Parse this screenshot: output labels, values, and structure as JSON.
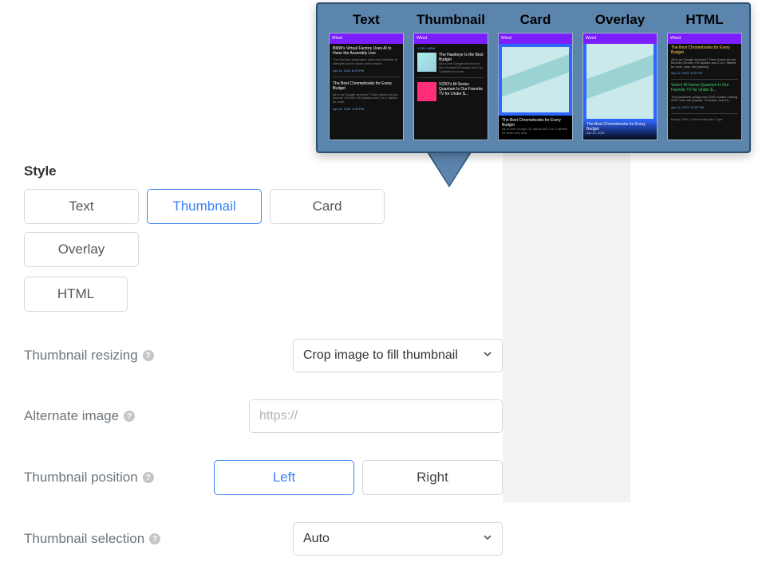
{
  "popover": {
    "cols": [
      {
        "label": "Text"
      },
      {
        "label": "Thumbnail"
      },
      {
        "label": "Card"
      },
      {
        "label": "Overlay"
      },
      {
        "label": "HTML"
      }
    ]
  },
  "style": {
    "label": "Style",
    "options": {
      "text": "Text",
      "thumbnail": "Thumbnail",
      "card": "Card",
      "overlay": "Overlay",
      "html": "HTML"
    },
    "selected": "thumbnail"
  },
  "thumbnail_resizing": {
    "label": "Thumbnail resizing",
    "value": "Crop image to fill thumbnail"
  },
  "alternate_image": {
    "label": "Alternate image",
    "placeholder": "https://",
    "value": ""
  },
  "thumbnail_position": {
    "label": "Thumbnail position",
    "left": "Left",
    "right": "Right",
    "selected": "left"
  },
  "thumbnail_selection": {
    "label": "Thumbnail selection",
    "value": "Auto"
  }
}
